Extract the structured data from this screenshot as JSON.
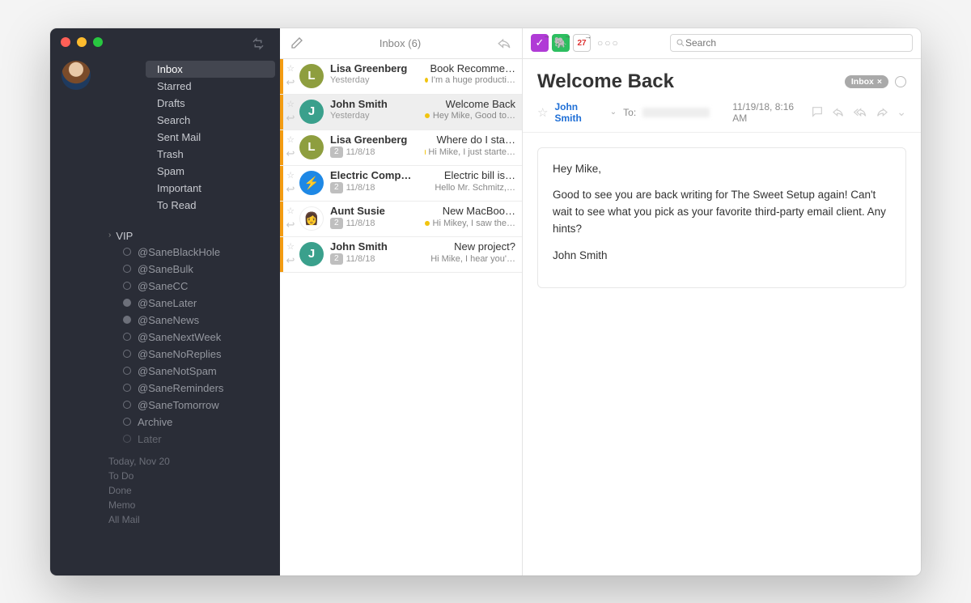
{
  "sidebar": {
    "folders": [
      "Inbox",
      "Starred",
      "Drafts",
      "Search",
      "Sent Mail",
      "Trash",
      "Spam",
      "Important",
      "To Read"
    ],
    "selected": "Inbox",
    "vip_label": "VIP",
    "subfolders": [
      "@SaneBlackHole",
      "@SaneBulk",
      "@SaneCC",
      "@SaneLater",
      "@SaneNews",
      "@SaneNextWeek",
      "@SaneNoReplies",
      "@SaneNotSpam",
      "@SaneReminders",
      "@SaneTomorrow",
      "Archive",
      "Later"
    ],
    "bottom": [
      "Today, Nov 20",
      "To Do",
      "Done",
      "Memo",
      "All Mail"
    ]
  },
  "list": {
    "title": "Inbox (6)",
    "messages": [
      {
        "sender": "Lisa Greenberg",
        "initial": "L",
        "color": "#8e9e3f",
        "subject": "Book Recomme…",
        "preview": "I'm a huge producti…",
        "date": "Yesterday",
        "count": null,
        "dot": true,
        "selected": false
      },
      {
        "sender": "John Smith",
        "initial": "J",
        "color": "#3aa08c",
        "subject": "Welcome Back",
        "preview": "Hey Mike, Good to…",
        "date": "Yesterday",
        "count": null,
        "dot": true,
        "selected": true
      },
      {
        "sender": "Lisa Greenberg",
        "initial": "L",
        "color": "#8e9e3f",
        "subject": "Where do I sta…",
        "preview": "Hi Mike, I just starte…",
        "date": "11/8/18",
        "count": "2",
        "dot": true,
        "selected": false
      },
      {
        "sender": "Electric Comp…",
        "initial": "⚡",
        "color": "#1e88e5",
        "subject": "Electric bill is…",
        "preview": "Hello Mr. Schmitz,…",
        "date": "11/8/18",
        "count": "2",
        "dot": false,
        "selected": false
      },
      {
        "sender": "Aunt Susie",
        "initial": "👩",
        "color": "#ffffff",
        "subject": "New MacBoo…",
        "preview": "Hi Mikey, I saw the…",
        "date": "11/8/18",
        "count": "2",
        "dot": true,
        "selected": false
      },
      {
        "sender": "John Smith",
        "initial": "J",
        "color": "#3aa08c",
        "subject": "New project?",
        "preview": "Hi Mike, I hear you'…",
        "date": "11/8/18",
        "count": "2",
        "dot": false,
        "selected": false
      }
    ]
  },
  "reading": {
    "subject": "Welcome Back",
    "tag": "Inbox",
    "from": "John Smith",
    "to_label": "To:",
    "timestamp": "11/19/18, 8:16 AM",
    "body_greeting": "Hey Mike,",
    "body_p1": "Good to see you are back writing for The Sweet Setup again! Can't wait to see what you pick as your favorite third-party email client. Any hints?",
    "body_sign": "John Smith",
    "search_placeholder": "Search"
  },
  "toolbar": {
    "icons": [
      {
        "name": "omnifocus-icon",
        "bg": "#b03bd6",
        "glyph": "✓"
      },
      {
        "name": "evernote-icon",
        "bg": "#2dbe60",
        "glyph": "🐘"
      },
      {
        "name": "calendar-icon",
        "bg": "#ffffff",
        "glyph": "27"
      }
    ]
  }
}
